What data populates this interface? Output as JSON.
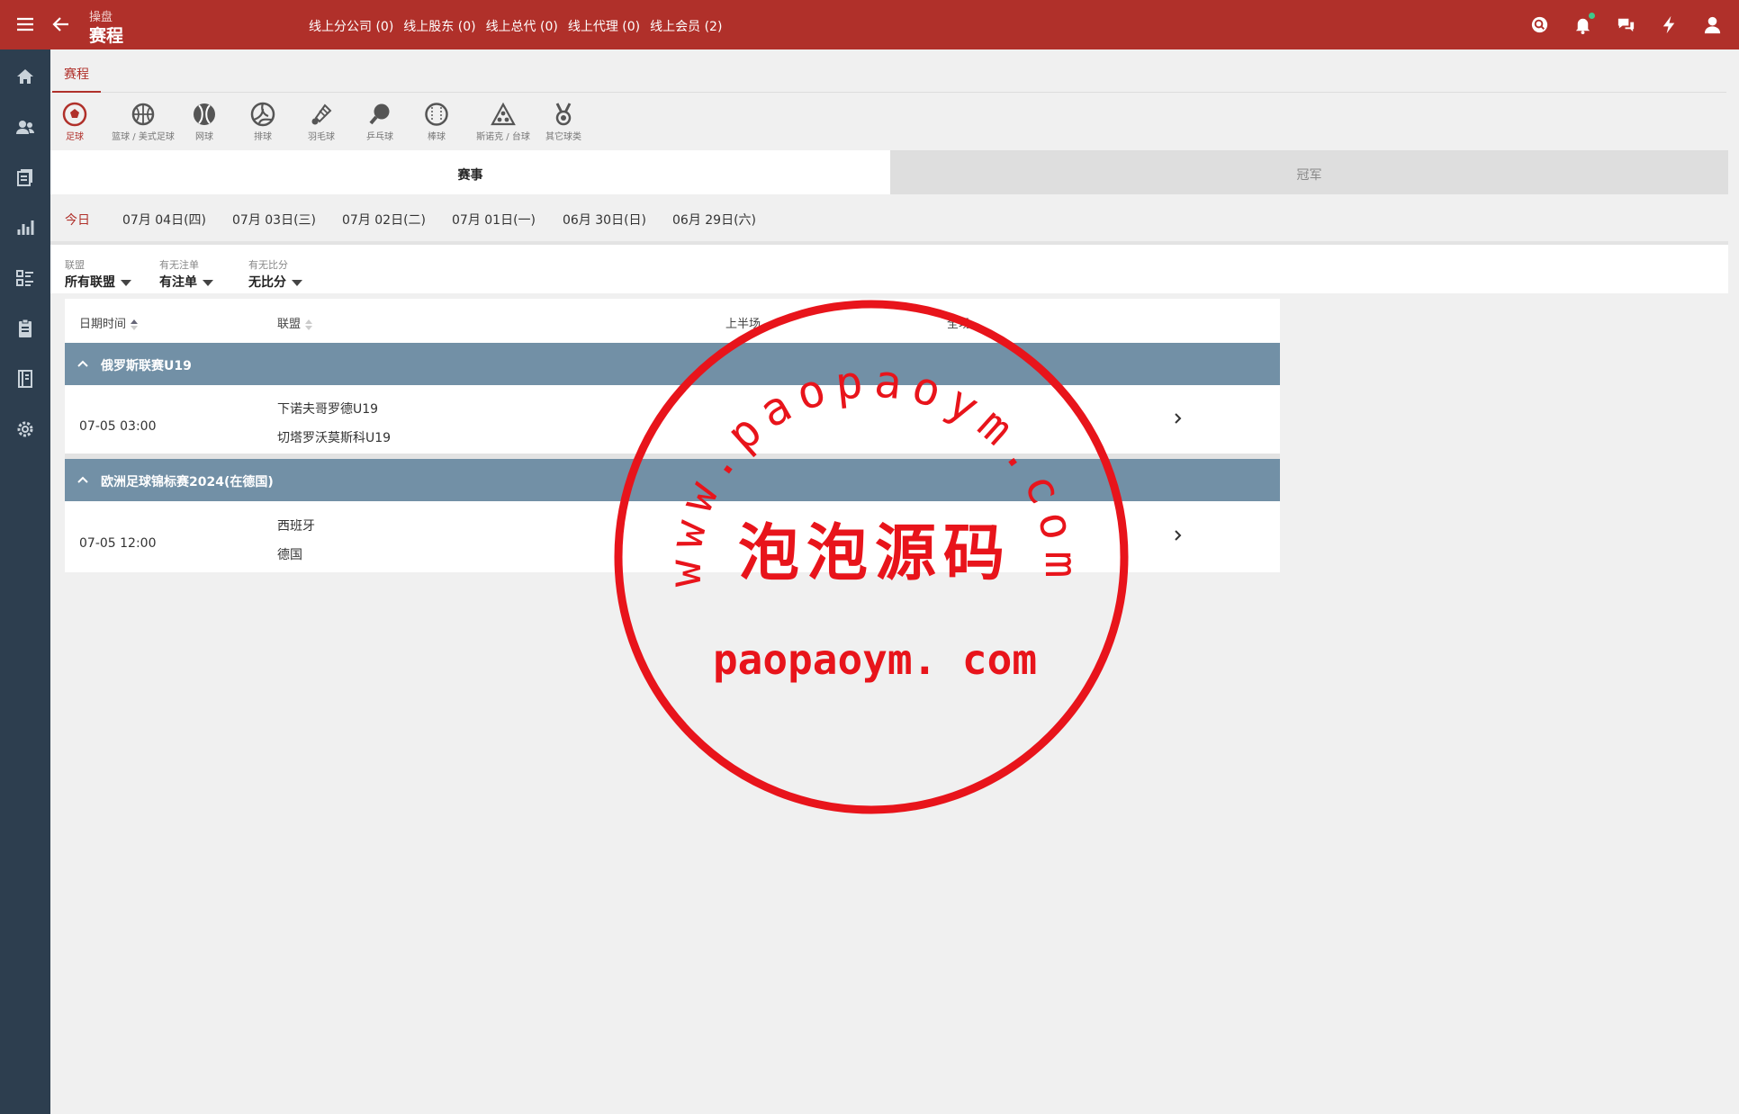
{
  "header": {
    "breadcrumb_parent": "操盘",
    "page_title": "赛程",
    "links": [
      "线上分公司 (0)",
      "线上股东 (0)",
      "线上总代 (0)",
      "线上代理 (0)",
      "线上会员 (2)"
    ],
    "icons": [
      "search-icon",
      "bell-icon",
      "chat-icon",
      "bolt-icon",
      "user-icon"
    ],
    "notification_dot_color": "#3fc98a"
  },
  "sidebar": {
    "icons": [
      "home-icon",
      "users-icon",
      "documents-icon",
      "bar-chart-icon",
      "list-icon",
      "clipboard-icon",
      "report-icon",
      "settings-icon"
    ]
  },
  "tab": {
    "label": "赛程"
  },
  "sports": [
    {
      "label": "足球",
      "icon": "soccer-icon",
      "active": true
    },
    {
      "label": "篮球 / 美式足球",
      "icon": "basketball-icon"
    },
    {
      "label": "网球",
      "icon": "tennis-icon"
    },
    {
      "label": "排球",
      "icon": "volleyball-icon"
    },
    {
      "label": "羽毛球",
      "icon": "badminton-icon"
    },
    {
      "label": "乒乓球",
      "icon": "table-tennis-icon"
    },
    {
      "label": "棒球",
      "icon": "baseball-icon"
    },
    {
      "label": "斯诺克 / 台球",
      "icon": "snooker-icon"
    },
    {
      "label": "其它球类",
      "icon": "medal-icon"
    }
  ],
  "subtabs": {
    "events": "赛事",
    "champion": "冠军"
  },
  "dates": [
    "今日",
    "07月 04日(四)",
    "07月 03日(三)",
    "07月 02日(二)",
    "07月 01日(一)",
    "06月 30日(日)",
    "06月 29日(六)"
  ],
  "filters": [
    {
      "label": "联盟",
      "value": "所有联盟"
    },
    {
      "label": "有无注单",
      "value": "有注单"
    },
    {
      "label": "有无比分",
      "value": "无比分"
    }
  ],
  "table": {
    "headers": {
      "datetime": "日期时间",
      "league": "联盟",
      "first_half": "上半场",
      "full_time": "全场"
    },
    "groups": [
      {
        "name": "俄罗斯联赛U19",
        "matches": [
          {
            "time": "07-05 03:00",
            "home": "下诺夫哥罗德U19",
            "away": "切塔罗沃莫斯科U19"
          }
        ]
      },
      {
        "name": "欧洲足球锦标赛2024(在德国)",
        "matches": [
          {
            "time": "07-05 12:00",
            "home": "西班牙",
            "away": "德国"
          }
        ]
      }
    ]
  },
  "watermark": {
    "ring_text": "www.paopaoym.com",
    "center_text": "泡泡源码",
    "bottom_text": "paopaoym. com",
    "color": "#e8141b"
  },
  "colors": {
    "brand": "#b0302a",
    "sidebar": "#2d3e4f",
    "group_header": "#7290a6"
  }
}
